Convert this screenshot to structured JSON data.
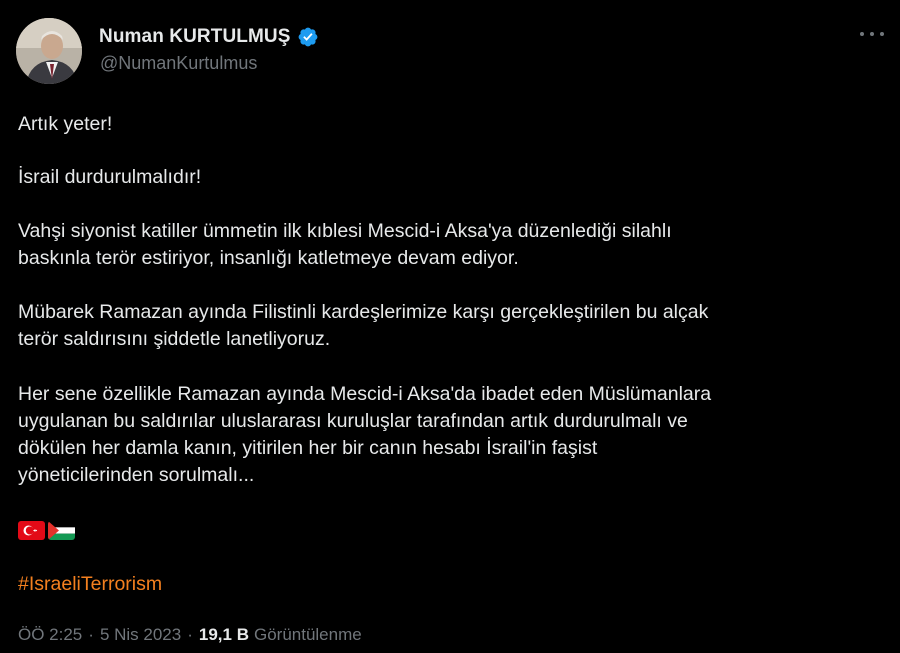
{
  "author": {
    "display_name": "Numan KURTULMUŞ",
    "handle": "@NumanKurtulmus",
    "verified_icon": "verified-badge-icon",
    "avatar_icon": "profile-photo"
  },
  "tweet": {
    "lines": [
      "Artık yeter!",
      "İsrail durdurulmalıdır!",
      "Vahşi siyonist katiller ümmetin ilk kıblesi Mescid-i Aksa'ya düzenlediği silahlı\nbaskınla terör estiriyor, insanlığı katletmeye devam ediyor.",
      "Mübarek Ramazan ayında Filistinli kardeşlerimize karşı gerçekleştirilen bu alçak\nterör saldırısını şiddetle lanetliyoruz.",
      "Her sene özellikle Ramazan ayında Mescid-i Aksa'da ibadet eden Müslümanlara\nuygulanan bu saldırılar uluslararası kuruluşlar tarafından artık durdurulmalı ve\ndökülen her damla kanın, yitirilen her bir canın hesabı İsrail'in faşist\nyöneticilerinden sorulmalı..."
    ],
    "flags": [
      "turkey-flag-icon",
      "palestine-flag-icon"
    ],
    "hashtag": "#IsraeliTerrorism"
  },
  "meta": {
    "time": "ÖÖ 2:25",
    "separator": "·",
    "date": "5 Nis 2023",
    "views_count": "19,1 B",
    "views_label": "Görüntülenme"
  },
  "colors": {
    "background": "#000000",
    "text": "#e7e9ea",
    "secondary_text": "#71767b",
    "hashtag": "#f4801f",
    "verified": "#1d9bf0"
  }
}
